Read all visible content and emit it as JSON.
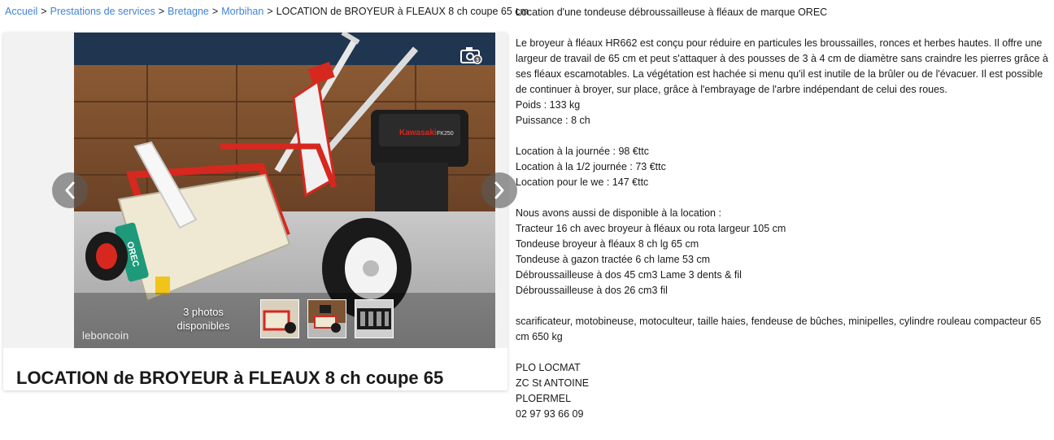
{
  "breadcrumb": {
    "items": [
      "Accueil",
      "Prestations de services",
      "Bretagne",
      "Morbihan"
    ],
    "current": "LOCATION de BROYEUR à FLEAUX 8 ch coupe 65 cm",
    "separator": ">"
  },
  "gallery": {
    "photo_count_line1": "3 photos",
    "photo_count_line2": "disponibles",
    "watermark": "leboncoin",
    "machine_brand": "OREC",
    "engine_brand": "Kawasaki",
    "engine_model": "FK250",
    "photo_total": 3,
    "prev_icon": "chevron-left-icon",
    "next_icon": "chevron-right-icon",
    "camera_icon": "camera-icon"
  },
  "ad": {
    "title": "LOCATION de BROYEUR à FLEAUX 8 ch coupe 65"
  },
  "description": {
    "lines": [
      "Location d'une tondeuse débroussailleuse à fléaux de marque OREC",
      "",
      "Le broyeur à fléaux HR662 est conçu pour réduire en particules les broussailles, ronces et herbes hautes. Il offre une largeur de travail de 65 cm et peut s'attaquer à des pousses de 3 à 4 cm de diamètre sans craindre les pierres grâce à ses fléaux escamotables. La végétation est hachée si menu qu'il est inutile de la brûler ou de l'évacuer. Il est possible de continuer à broyer, sur place, grâce à l'embrayage de l'arbre indépendant de celui des roues.",
      "Poids : 133 kg",
      "Puissance : 8 ch",
      "",
      "Location à la journée : 98 €ttc",
      "Location à la 1/2 journée : 73 €ttc",
      "Location pour le we : 147 €ttc",
      "",
      "Nous avons aussi de disponible à la location :",
      "Tracteur 16 ch avec broyeur à fléaux ou rota largeur 105 cm",
      "Tondeuse broyeur à fléaux 8 ch lg 65 cm",
      "Tondeuse à gazon tractée 6 ch lame 53 cm",
      "Débroussailleuse à dos 45 cm3 Lame 3 dents & fil",
      "Débroussailleuse à dos 26 cm3 fil",
      "",
      "scarificateur, motobineuse, motoculteur, taille haies, fendeuse de bûches, minipelles, cylindre rouleau compacteur 65 cm 650 kg",
      "",
      "PLO LOCMAT",
      "ZC St ANTOINE",
      "PLOERMEL",
      "02 97 93 66 09"
    ]
  },
  "colors": {
    "link": "#4183d7",
    "text": "#1a1a1a",
    "machine_red": "#d6281f",
    "machine_white": "#f1eee0",
    "orec_green": "#1e9a7a"
  }
}
